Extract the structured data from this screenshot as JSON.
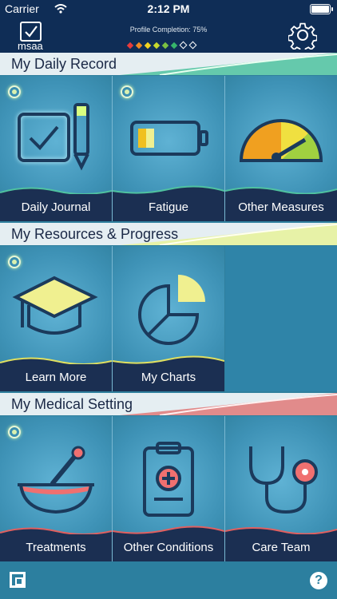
{
  "status_bar": {
    "carrier": "Carrier",
    "time": "2:12 PM"
  },
  "header": {
    "logo_text": "msaa",
    "profile_label": "Profile Completion: 75%",
    "profile_completion_percent": 75,
    "diamond_colors": [
      "#e83b3b",
      "#f08a24",
      "#f2d420",
      "#c6d92c",
      "#7cc242",
      "#36b56b",
      "#ffffff",
      "#ffffff"
    ]
  },
  "sections": [
    {
      "title": "My Daily Record",
      "tiles": [
        {
          "label": "Daily Journal",
          "icon": "checkbox-pencil-icon"
        },
        {
          "label": "Fatigue",
          "icon": "battery-icon"
        },
        {
          "label": "Other Measures",
          "icon": "gauge-icon"
        }
      ]
    },
    {
      "title": "My Resources & Progress",
      "tiles": [
        {
          "label": "Learn More",
          "icon": "graduation-cap-icon"
        },
        {
          "label": "My Charts",
          "icon": "pie-chart-icon"
        }
      ]
    },
    {
      "title": "My Medical Setting",
      "tiles": [
        {
          "label": "Treatments",
          "icon": "mortar-pestle-icon"
        },
        {
          "label": "Other Conditions",
          "icon": "medical-clipboard-icon"
        },
        {
          "label": "Care Team",
          "icon": "stethoscope-icon"
        }
      ]
    }
  ],
  "bottom_bar": {
    "help_glyph": "?"
  },
  "colors": {
    "accent_green": "#d9ff80",
    "accent_red": "#f07070",
    "accent_yellow": "#f0f090",
    "navy": "#0f2d56"
  }
}
